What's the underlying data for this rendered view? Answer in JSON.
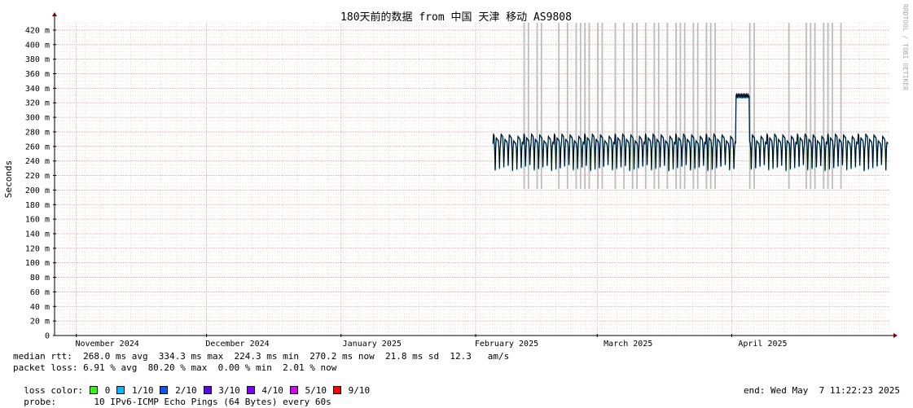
{
  "chart_data": {
    "type": "line",
    "title": "180天前的数据 from 中国 天津 移动 AS9808",
    "ylabel": "Seconds",
    "ylim": [
      0,
      430
    ],
    "yticks": [
      0,
      20,
      40,
      60,
      80,
      100,
      120,
      140,
      160,
      180,
      200,
      220,
      240,
      260,
      280,
      300,
      320,
      340,
      360,
      380,
      400,
      420
    ],
    "ytick_labels": [
      "0",
      "20 m",
      "40 m",
      "60 m",
      "80 m",
      "100 m",
      "120 m",
      "140 m",
      "160 m",
      "180 m",
      "200 m",
      "220 m",
      "240 m",
      "260 m",
      "280 m",
      "300 m",
      "320 m",
      "340 m",
      "360 m",
      "380 m",
      "400 m",
      "420 m"
    ],
    "xlim": [
      "2024-10-27",
      "2025-05-07"
    ],
    "xticks": [
      {
        "date": "2024-11-01",
        "label": "November 2024"
      },
      {
        "date": "2024-12-01",
        "label": "December 2024"
      },
      {
        "date": "2025-01-01",
        "label": "January 2025"
      },
      {
        "date": "2025-02-01",
        "label": "February 2025"
      },
      {
        "date": "2025-03-01",
        "label": "March 2025"
      },
      {
        "date": "2025-04-01",
        "label": "April 2025"
      }
    ],
    "grid": true,
    "series": [
      {
        "name": "median rtt",
        "color": "#000000",
        "data_start": "2025-02-05",
        "data_end": "2025-05-07",
        "baseline_ms": 270,
        "daily_min_ms": 227,
        "elevated_period": [
          "2025-04-02",
          "2025-04-05"
        ],
        "elevated_ms": 330
      }
    ],
    "loss_spikes": [
      "2025-02-12",
      "2025-02-13",
      "2025-02-15",
      "2025-02-16",
      "2025-02-20",
      "2025-02-22",
      "2025-02-24",
      "2025-02-25",
      "2025-02-26",
      "2025-02-27",
      "2025-03-01",
      "2025-03-02",
      "2025-03-05",
      "2025-03-07",
      "2025-03-09",
      "2025-03-10",
      "2025-03-12",
      "2025-03-14",
      "2025-03-15",
      "2025-03-17",
      "2025-03-19",
      "2025-03-20",
      "2025-03-21",
      "2025-03-23",
      "2025-03-24",
      "2025-03-26",
      "2025-03-27",
      "2025-03-28",
      "2025-04-05",
      "2025-04-06",
      "2025-04-14",
      "2025-04-18",
      "2025-04-19",
      "2025-04-20",
      "2025-04-22",
      "2025-04-23",
      "2025-04-24",
      "2025-04-26"
    ]
  },
  "watermark": "RRDTOOL / TOBI OETIKER",
  "stats": {
    "median_rtt": "median rtt:  268.0 ms avg  334.3 ms max  224.3 ms min  270.2 ms now  21.8 ms sd  12.3   am/s",
    "packet_loss": "packet loss: 6.91 % avg  80.20 % max  0.00 % min  2.01 % now",
    "loss_color_label": "loss color:",
    "loss_colors": [
      {
        "label": "0",
        "color": "#26ff00"
      },
      {
        "label": "1/10",
        "color": "#00b8ff"
      },
      {
        "label": "2/10",
        "color": "#0059ff"
      },
      {
        "label": "3/10",
        "color": "#5e00ff"
      },
      {
        "label": "4/10",
        "color": "#7e00ff"
      },
      {
        "label": "5/10",
        "color": "#dd00ff"
      },
      {
        "label": "9/10",
        "color": "#ff0000"
      }
    ],
    "probe_label": "probe:",
    "probe_text": "10 IPv6-ICMP Echo Pings (64 Bytes) every 60s",
    "end_text": "end: Wed May  7 11:22:23 2025"
  }
}
